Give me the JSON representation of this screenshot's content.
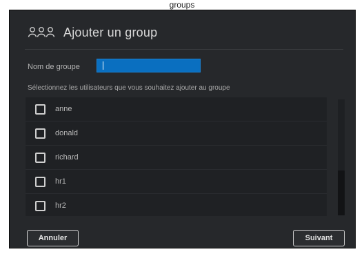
{
  "window_caption": "groups",
  "dialog": {
    "title": "Ajouter un group",
    "title_icon": "users-group-icon"
  },
  "form": {
    "group_name_label": "Nom de groupe",
    "group_name_value": "",
    "instruction": "Sélectionnez les utilisateurs que vous souhaitez ajouter au groupe"
  },
  "users": [
    {
      "name": "anne",
      "checked": false
    },
    {
      "name": "donald",
      "checked": false
    },
    {
      "name": "richard",
      "checked": false
    },
    {
      "name": "hr1",
      "checked": false
    },
    {
      "name": "hr2",
      "checked": false
    }
  ],
  "buttons": {
    "cancel": "Annuler",
    "next": "Suivant"
  },
  "colors": {
    "dialog_bg": "#26282b",
    "input_accent": "#0a6fc0"
  }
}
